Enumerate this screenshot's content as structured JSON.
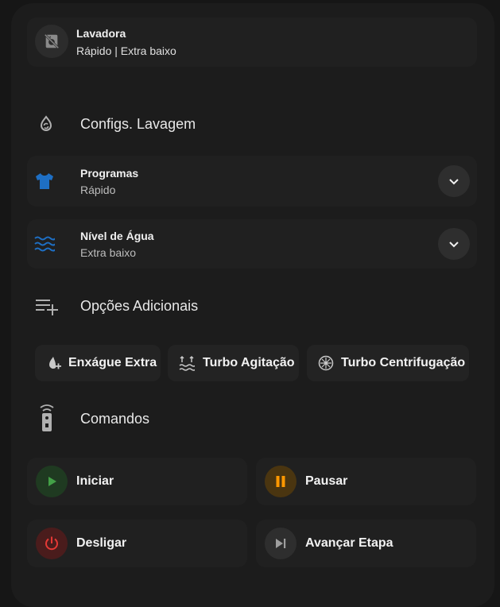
{
  "device": {
    "name": "Lavadora",
    "status": "Rápido | Extra baixo",
    "icon": "washing-machine-off-icon"
  },
  "sections": {
    "wash_settings": {
      "title": "Configs. Lavagem",
      "icon": "water-sync-icon"
    },
    "additional_options": {
      "title": "Opções Adicionais",
      "icon": "playlist-plus-icon"
    },
    "commands": {
      "title": "Comandos",
      "icon": "remote-icon"
    }
  },
  "selects": {
    "program": {
      "label": "Programas",
      "value": "Rápido",
      "icon": "tshirt-icon",
      "icon_color": "#1e6fc4"
    },
    "water_level": {
      "label": "Nível de Água",
      "value": "Extra baixo",
      "icon": "waves-icon",
      "icon_color": "#1e6fc4"
    }
  },
  "options": [
    {
      "label": "Enxágue Extra",
      "icon": "water-plus-icon"
    },
    {
      "label": "Turbo Agitação",
      "icon": "waves-arrow-up-icon"
    },
    {
      "label": "Turbo Centrifugação",
      "icon": "fan-icon"
    }
  ],
  "commands": [
    {
      "label": "Iniciar",
      "icon": "play-icon",
      "color": "#43a047"
    },
    {
      "label": "Pausar",
      "icon": "pause-icon",
      "color": "#ff9800"
    },
    {
      "label": "Desligar",
      "icon": "power-icon",
      "color": "#e53935"
    },
    {
      "label": "Avançar Etapa",
      "icon": "skip-next-icon",
      "color": "#9e9e9e"
    }
  ]
}
